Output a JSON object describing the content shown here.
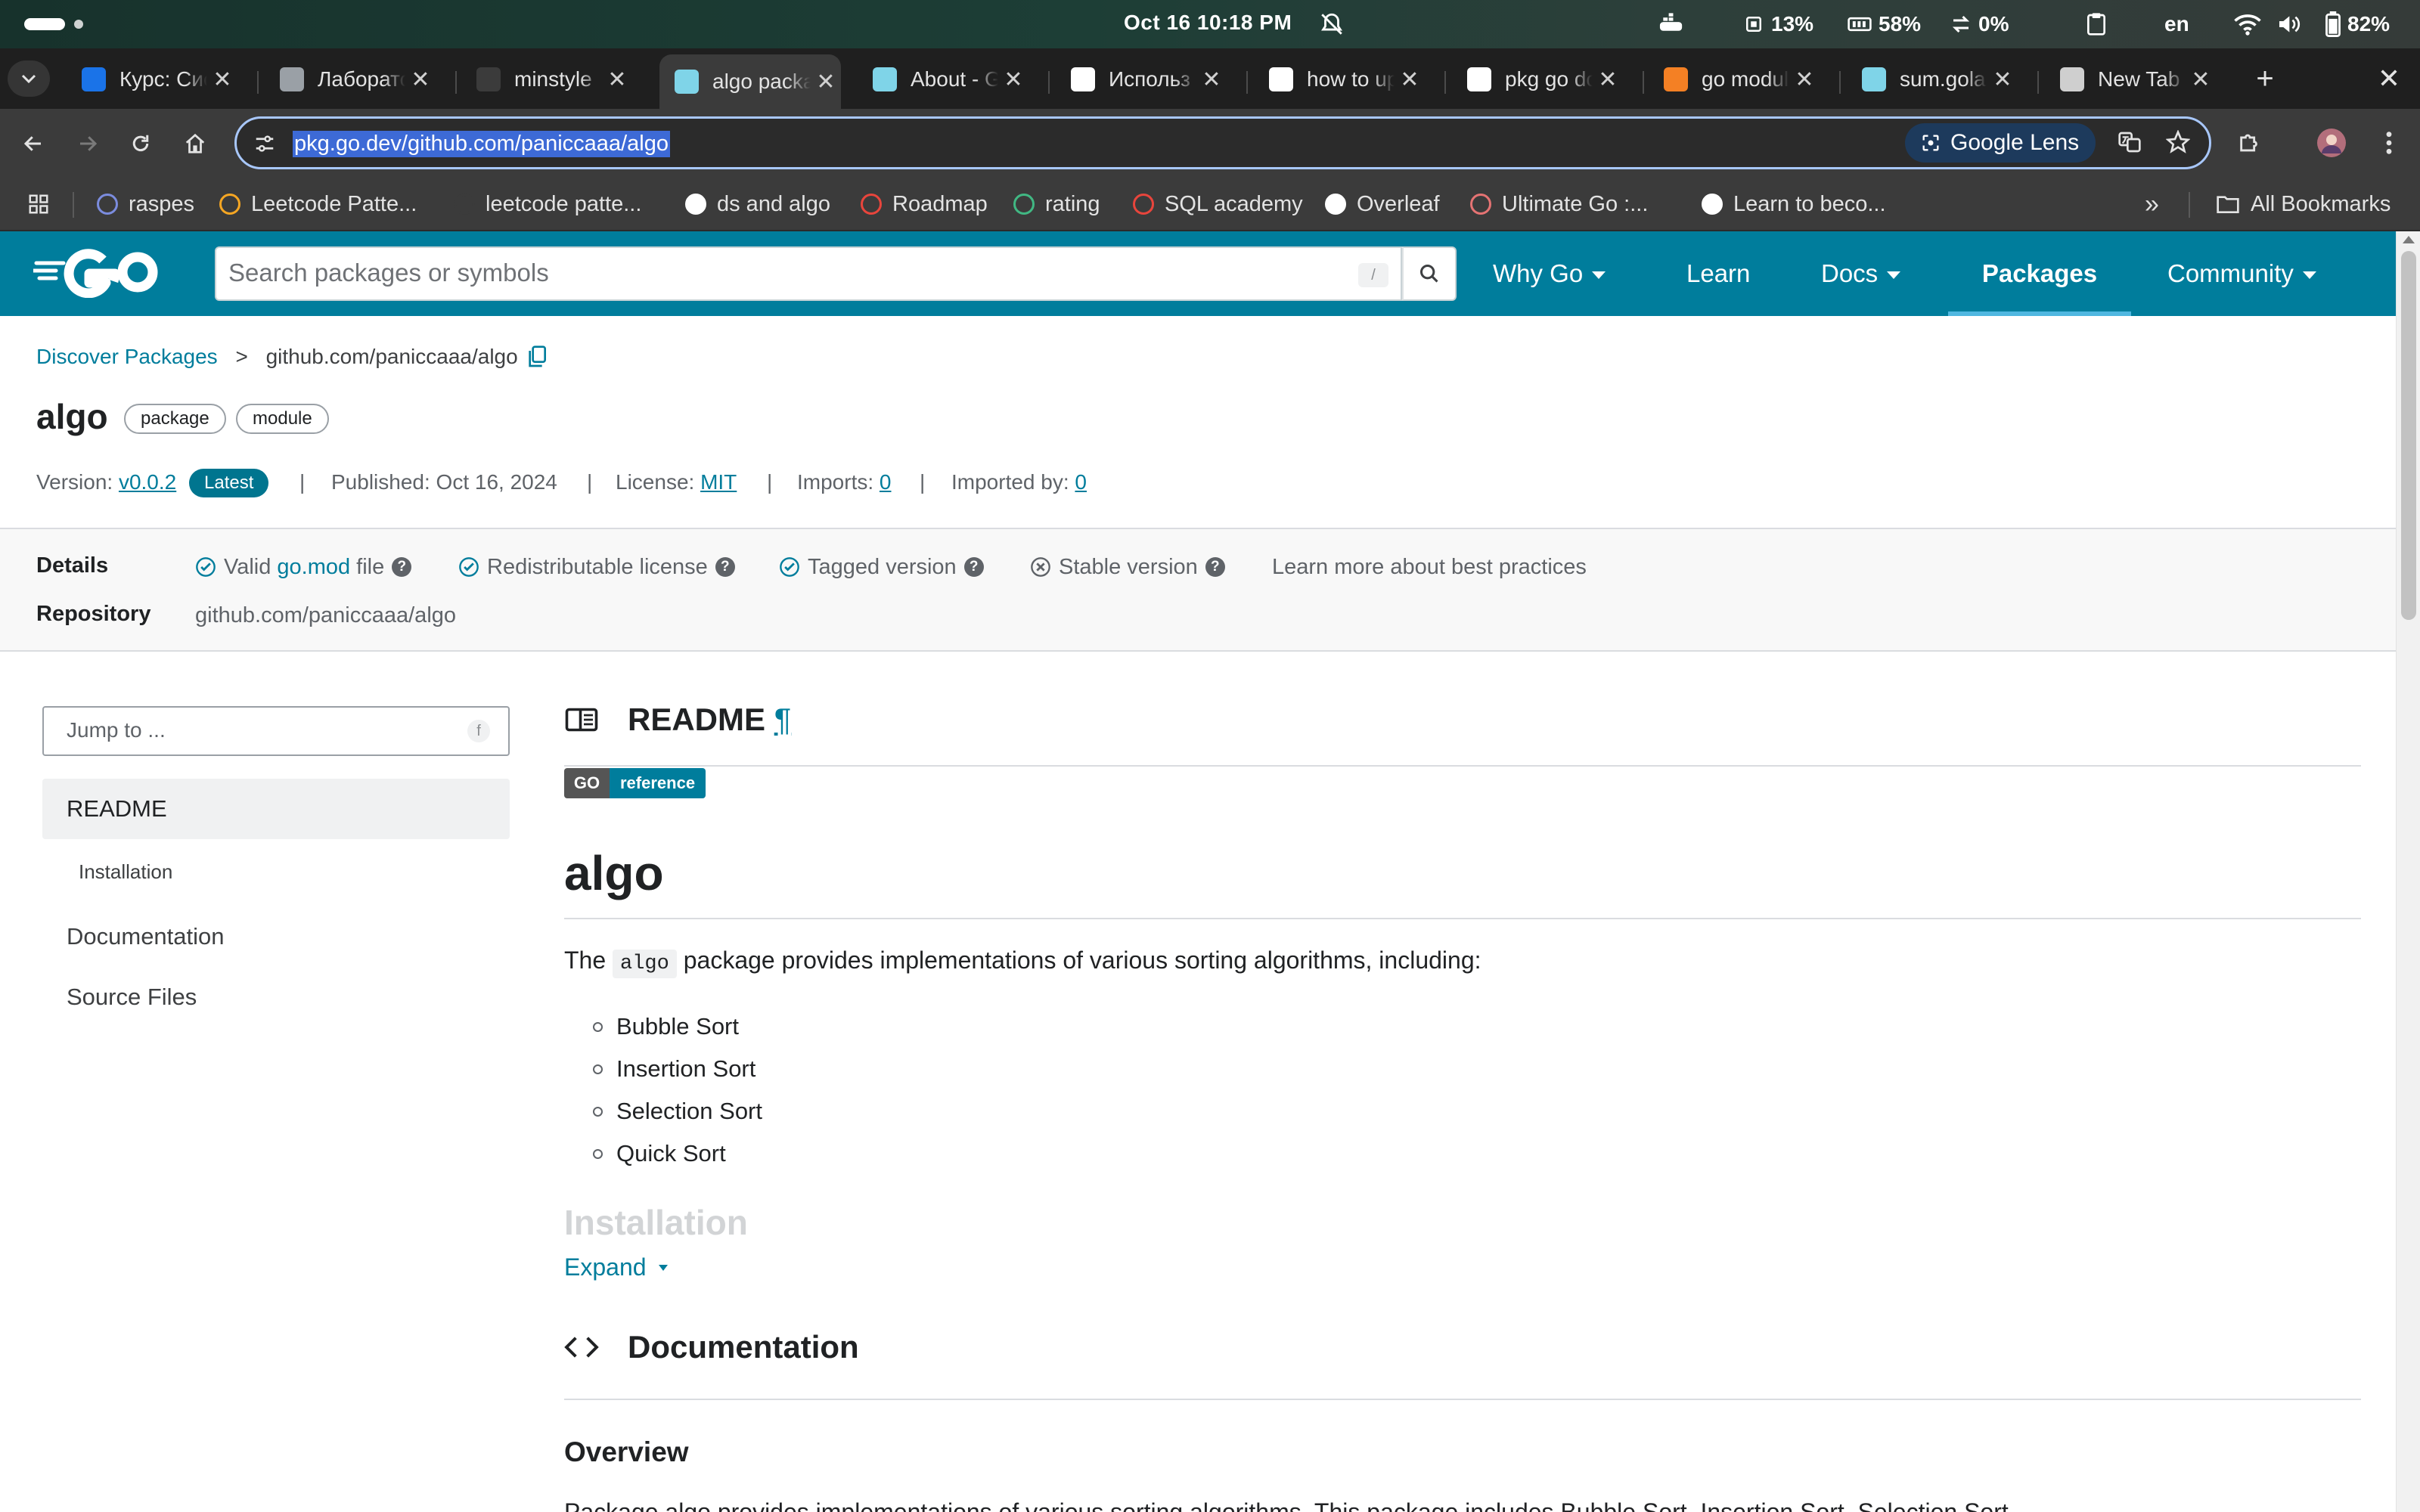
{
  "os": {
    "clock": "Oct 16  10:18 PM",
    "cpu": "13%",
    "memory": "58%",
    "network": "0%",
    "keyboard_layout": "en",
    "battery": "82%"
  },
  "tabs": [
    {
      "title": "Курс: Систе",
      "favicon": "moodle-icon",
      "color": "#1a73e8"
    },
    {
      "title": "Лаборатор",
      "favicon": "globe-icon",
      "color": "#9aa0a6"
    },
    {
      "title": "minstyle",
      "favicon": "github-icon",
      "color": "#3b3b3b"
    },
    {
      "title": "algo package",
      "favicon": "gopher-icon",
      "color": "#7fd4e8"
    },
    {
      "title": "About - G",
      "favicon": "gopher-icon",
      "color": "#7fd4e8"
    },
    {
      "title": "Использ",
      "favicon": "openai-icon",
      "color": "#ffffff"
    },
    {
      "title": "how to up",
      "favicon": "google-icon",
      "color": "#ffffff"
    },
    {
      "title": "pkg go do",
      "favicon": "google-icon",
      "color": "#ffffff"
    },
    {
      "title": "go modul",
      "favicon": "stackoverflow-icon",
      "color": "#f48024"
    },
    {
      "title": "sum.golan",
      "favicon": "gopher-icon",
      "color": "#7fd4e8"
    },
    {
      "title": "New Tab",
      "favicon": "chrome-icon",
      "color": "#cfcfcf"
    }
  ],
  "address_bar": {
    "url": "pkg.go.dev/github.com/paniccaaa/algo",
    "lens_label": "Google Lens"
  },
  "bookmarks": [
    {
      "label": "raspes",
      "icon": "raspes-icon",
      "color": "#7b8cde"
    },
    {
      "label": "Leetcode Patte...",
      "icon": "leetcode-icon",
      "color": "#f5a623"
    },
    {
      "label": "leetcode patte...",
      "icon": "github-icon",
      "color": "#3b3b3b"
    },
    {
      "label": "ds and algo",
      "icon": "notion-icon",
      "color": "#ffffff"
    },
    {
      "label": "Roadmap",
      "icon": "rocket-icon",
      "color": "#e8453c"
    },
    {
      "label": "rating",
      "icon": "vue-icon",
      "color": "#41b883"
    },
    {
      "label": "SQL academy",
      "icon": "search-icon",
      "color": "#e8453c"
    },
    {
      "label": "Overleaf",
      "icon": "overleaf-icon",
      "color": "#ffffff"
    },
    {
      "label": "Ultimate Go :...",
      "icon": "ardanlabs-icon",
      "color": "#e57373"
    },
    {
      "label": "Learn to beco...",
      "icon": "notion-icon",
      "color": "#ffffff"
    }
  ],
  "bookmarks_overflow": "»",
  "all_bookmarks_label": "All Bookmarks",
  "site": {
    "search_placeholder": "Search packages or symbols",
    "search_shortcut": "/",
    "nav": [
      {
        "label": "Why Go",
        "dropdown": true
      },
      {
        "label": "Learn",
        "dropdown": false
      },
      {
        "label": "Docs",
        "dropdown": true
      },
      {
        "label": "Packages",
        "dropdown": false,
        "active": true
      },
      {
        "label": "Community",
        "dropdown": true
      }
    ]
  },
  "breadcrumb": {
    "root": "Discover Packages",
    "separator": ">",
    "current": "github.com/paniccaaa/algo"
  },
  "package": {
    "name": "algo",
    "chips": [
      "package",
      "module"
    ],
    "version_label": "Version:",
    "version": "v0.0.2",
    "latest_badge": "Latest",
    "published_label": "Published:",
    "published": "Oct 16, 2024",
    "license_label": "License:",
    "license": "MIT",
    "imports_label": "Imports:",
    "imports": "0",
    "imported_by_label": "Imported by:",
    "imported_by": "0",
    "separator": "|"
  },
  "details": {
    "label": "Details",
    "checks": [
      {
        "prefix": "Valid ",
        "link": "go.mod",
        "suffix": " file",
        "ok": true
      },
      {
        "prefix": "Redistributable license",
        "link": "",
        "suffix": "",
        "ok": true
      },
      {
        "prefix": "Tagged version",
        "link": "",
        "suffix": "",
        "ok": true
      },
      {
        "prefix": "Stable version",
        "link": "",
        "suffix": "",
        "ok": false
      }
    ],
    "help_mark": "?",
    "best_practices_link": "Learn more about best practices",
    "repository_label": "Repository",
    "repository": "github.com/paniccaaa/algo"
  },
  "sidebar": {
    "jump_placeholder": "Jump to ...",
    "jump_shortcut": "f",
    "items": [
      {
        "label": "README",
        "selected": true,
        "sub": false
      },
      {
        "label": "Installation",
        "selected": false,
        "sub": true
      },
      {
        "label": "Documentation",
        "selected": false,
        "sub": false
      },
      {
        "label": "Source Files",
        "selected": false,
        "sub": false
      }
    ]
  },
  "readme": {
    "heading": "README",
    "anchor": "¶",
    "badge_left": "GO",
    "badge_right": "reference",
    "h1": "algo",
    "desc_before": "The ",
    "desc_code": "algo",
    "desc_after": " package provides implementations of various sorting algorithms, including:",
    "list": [
      "Bubble Sort",
      "Insertion Sort",
      "Selection Sort",
      "Quick Sort"
    ],
    "faded_heading": "Installation",
    "expand_label": "Expand"
  },
  "documentation": {
    "heading": "Documentation",
    "overview": "Overview",
    "cut_line": "Package algo provides implementations of various sorting algorithms. This package includes Bubble Sort, Insertion Sort, Selection Sort"
  }
}
